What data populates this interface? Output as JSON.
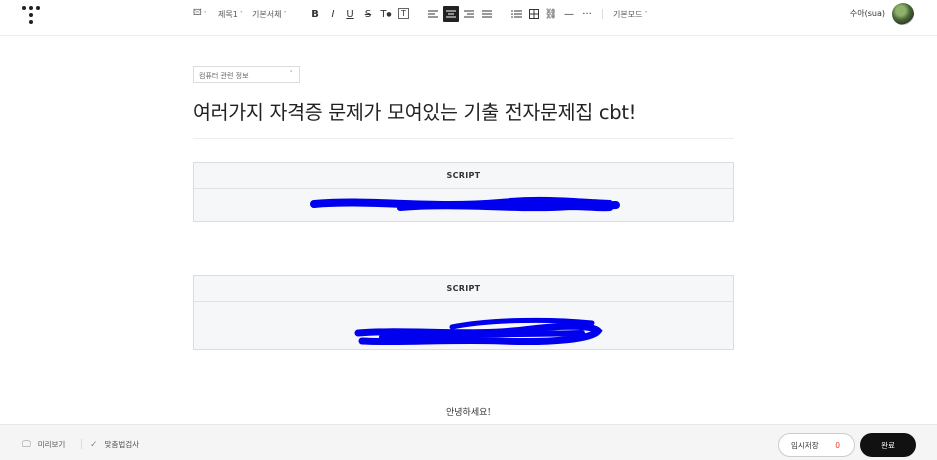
{
  "toolbar": {
    "image_icon": "image-icon",
    "heading_label": "제목1",
    "font_label": "기본서체",
    "bold": "B",
    "italic": "I",
    "underline": "U",
    "strike": "S",
    "text_color": "T",
    "text_bg": "T",
    "mode_label": "기본모드",
    "more": "···",
    "hr": "—"
  },
  "user": {
    "name": "수아(sua)"
  },
  "post": {
    "category": "컴퓨터 관련 정보",
    "title": "여러가지 자격증 문제가 모여있는 기출 전자문제집 cbt!",
    "script_blocks": [
      {
        "header": "SCRIPT"
      },
      {
        "header": "SCRIPT"
      }
    ],
    "greeting": "안녕하세요!"
  },
  "bottom": {
    "preview": "미리보기",
    "spellcheck": "맞춤법검사",
    "temp_save": "임시저장",
    "temp_count": "0",
    "done": "완료"
  },
  "colors": {
    "scribble": "#0000ee",
    "accent_red": "#f53535"
  }
}
